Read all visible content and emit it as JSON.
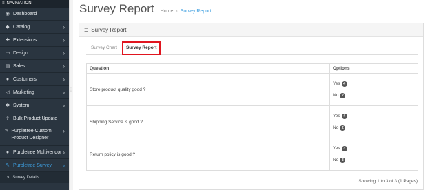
{
  "sidebar": {
    "header": "NAVIGATION",
    "items": [
      {
        "label": "Dashboard",
        "icon": "dashboard-icon",
        "glyph": "◉",
        "chevron": false
      },
      {
        "label": "Catalog",
        "icon": "tag-icon",
        "glyph": "◆",
        "chevron": true
      },
      {
        "label": "Extensions",
        "icon": "puzzle-icon",
        "glyph": "✚",
        "chevron": true
      },
      {
        "label": "Design",
        "icon": "monitor-icon",
        "glyph": "▭",
        "chevron": true
      },
      {
        "label": "Sales",
        "icon": "cart-icon",
        "glyph": "▤",
        "chevron": true
      },
      {
        "label": "Customers",
        "icon": "user-icon",
        "glyph": "●",
        "chevron": true
      },
      {
        "label": "Marketing",
        "icon": "share-icon",
        "glyph": "◁",
        "chevron": true
      },
      {
        "label": "System",
        "icon": "gear-icon",
        "glyph": "✱",
        "chevron": true
      },
      {
        "label": "Bulk Product Update",
        "icon": "upload-icon",
        "glyph": "⇧",
        "chevron": false
      },
      {
        "label": "Purpletree Custom Product Designer",
        "icon": "brush-icon",
        "glyph": "✎",
        "chevron": true
      },
      {
        "label": "Purpletree Multivendor",
        "icon": "user-icon",
        "glyph": "●",
        "chevron": true
      },
      {
        "label": "Purpletree Survey",
        "icon": "edit-icon",
        "glyph": "✎",
        "chevron": true
      }
    ],
    "subitem": "Survey Details"
  },
  "header": {
    "title": "Survey Report",
    "breadcrumb": [
      "Home",
      "Survey Report"
    ]
  },
  "panel": {
    "title": "Survey Report",
    "tabs": [
      "Survey Chart",
      "Survey Report"
    ],
    "active_tab": "Survey Report",
    "columns": [
      "Question",
      "Options"
    ],
    "rows": [
      {
        "question": "Store product quality good ?",
        "options": [
          {
            "label": "Yes",
            "count": "4"
          },
          {
            "label": "No",
            "count": "2"
          }
        ]
      },
      {
        "question": "Shipping Service is good ?",
        "options": [
          {
            "label": "Yes",
            "count": "4"
          },
          {
            "label": "No",
            "count": "2"
          }
        ]
      },
      {
        "question": "Return policy is good ?",
        "options": [
          {
            "label": "Yes",
            "count": "3"
          },
          {
            "label": "No",
            "count": "3"
          }
        ]
      }
    ],
    "pagination": "Showing 1 to 3 of 3 (1 Pages)"
  },
  "colors": {
    "sidebar_bg": "#2a3540",
    "accent": "#3e9fe0",
    "tab_highlight": "#e0151f"
  }
}
